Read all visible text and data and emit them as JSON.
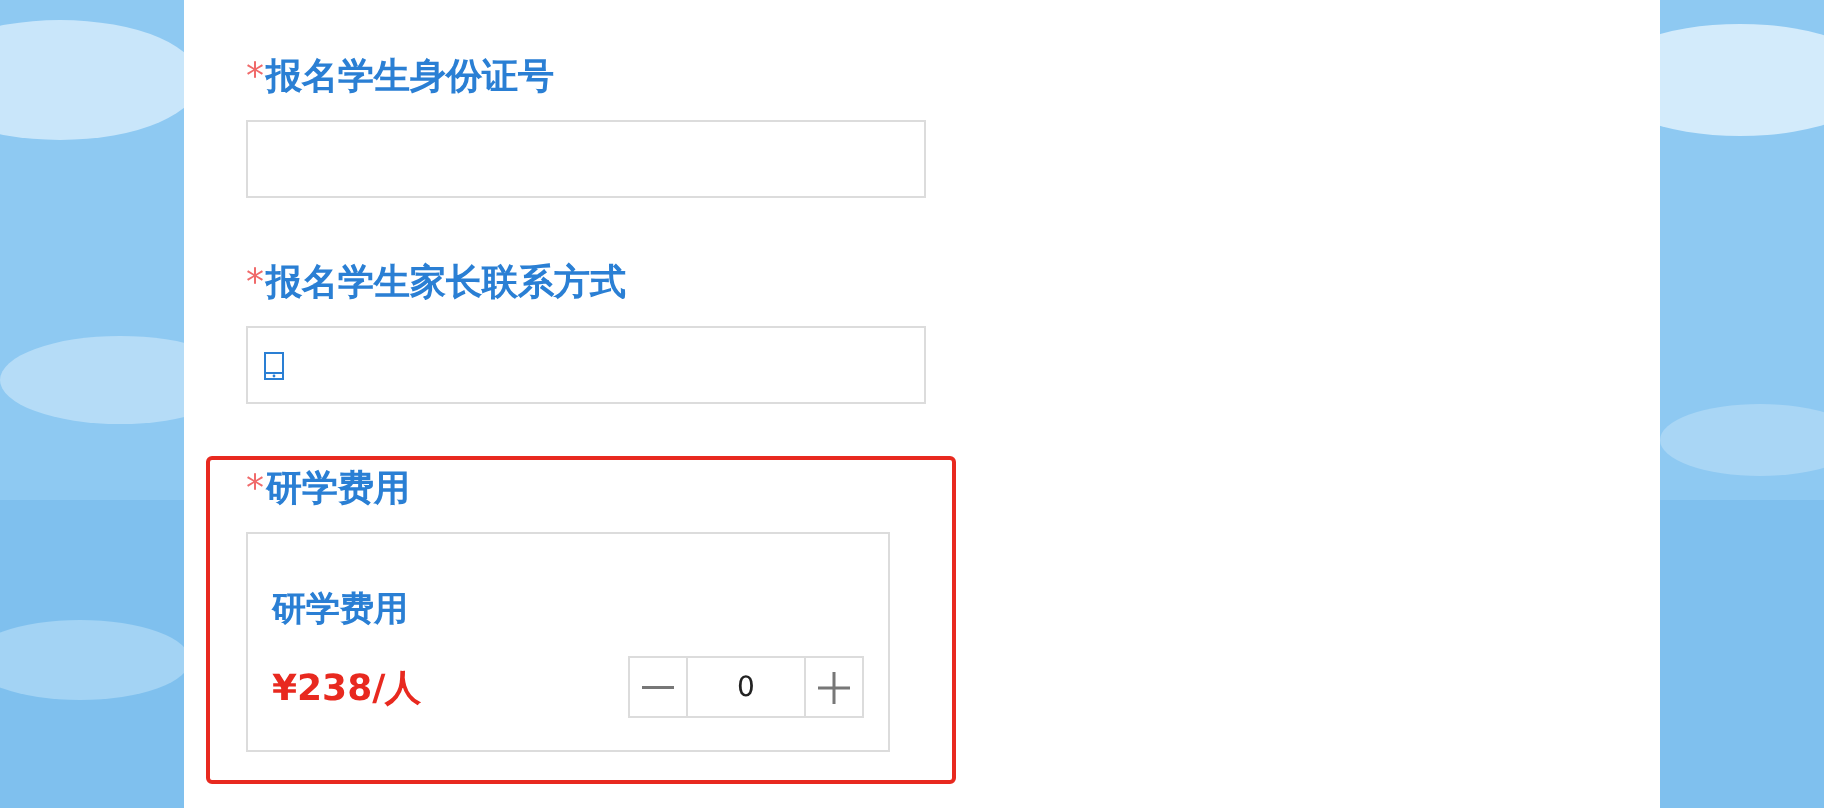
{
  "fields": [
    {
      "kind": "text",
      "label": "报名学生身份证号",
      "required_mark": "*",
      "highlighted": false
    },
    {
      "kind": "phone",
      "label": "报名学生家长联系方式",
      "required_mark": "*",
      "highlighted": false
    },
    {
      "kind": "product",
      "label": "研学费用",
      "required_mark": "*",
      "highlighted": true,
      "product": {
        "name": "研学费用",
        "price": "¥238/人",
        "quantity": "0"
      }
    }
  ]
}
